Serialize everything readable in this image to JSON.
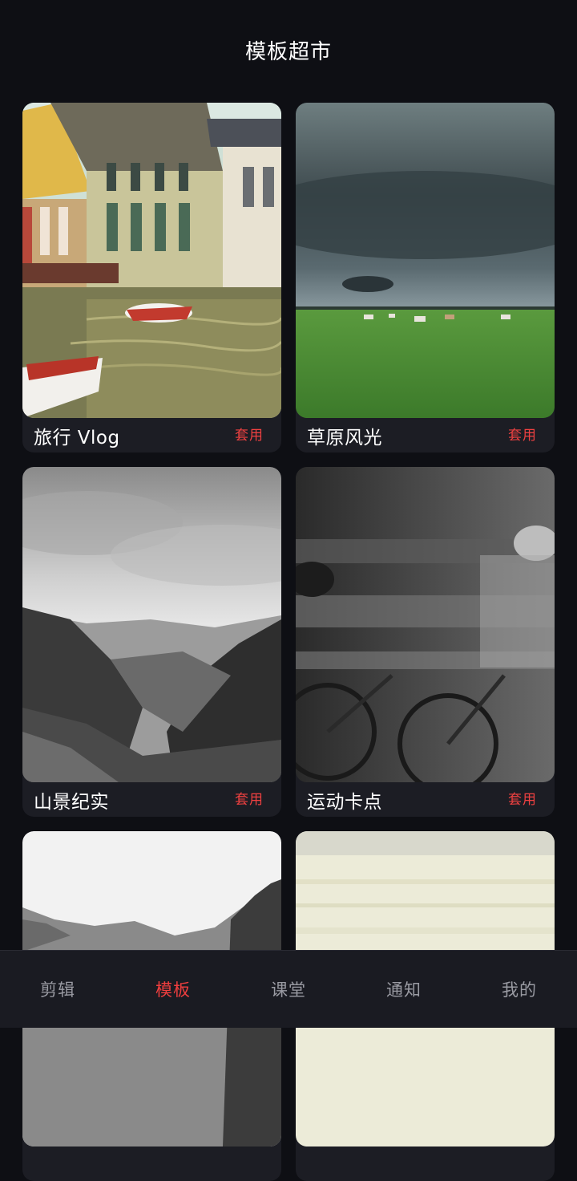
{
  "header": {
    "title": "模板超市"
  },
  "templates": [
    {
      "name": "旅行 Vlog",
      "use_label": "套用",
      "image": "canal-town-photo"
    },
    {
      "name": "草原风光",
      "use_label": "套用",
      "image": "grassland-storm-photo"
    },
    {
      "name": "山景纪实",
      "use_label": "套用",
      "image": "mountain-forest-bw-photo"
    },
    {
      "name": "运动卡点",
      "use_label": "套用",
      "image": "cyclists-motion-bw-photo"
    },
    {
      "image": "foggy-hills-photo"
    },
    {
      "image": "sea-horizon-photo"
    }
  ],
  "tabbar": {
    "items": [
      {
        "label": "剪辑"
      },
      {
        "label": "模板"
      },
      {
        "label": "课堂"
      },
      {
        "label": "通知"
      },
      {
        "label": "我的"
      }
    ],
    "active_index": 1
  },
  "colors": {
    "background": "#0e0f14",
    "card": "#1c1d24",
    "accent": "#ef3e3e",
    "tab_inactive": "#9a9ba3"
  }
}
